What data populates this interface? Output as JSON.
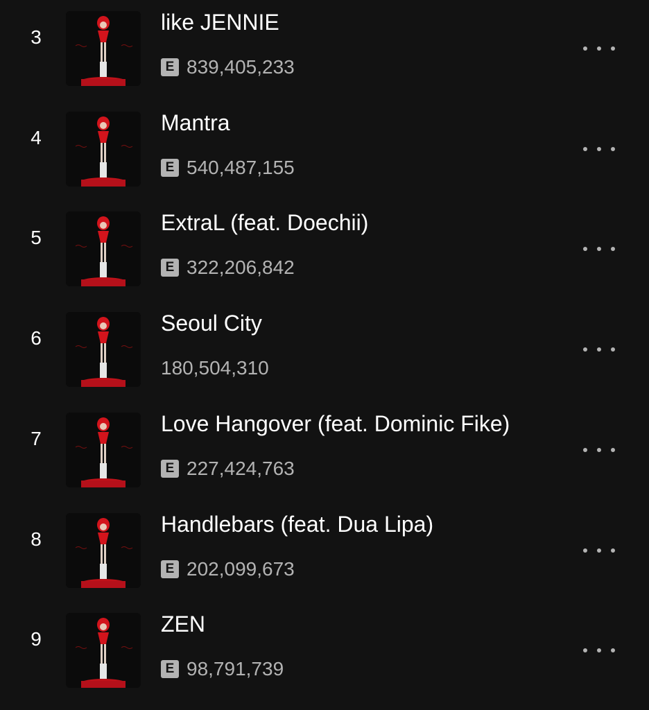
{
  "accent_explicit_bg": "#b3b3b3",
  "tracks": [
    {
      "rank": "3",
      "title": "like JENNIE",
      "explicit": true,
      "explicit_label": "E",
      "plays": "839,405,233",
      "cover_icon": "album-cover-ruby",
      "more_icon": "more-options-icon"
    },
    {
      "rank": "4",
      "title": "Mantra",
      "explicit": true,
      "explicit_label": "E",
      "plays": "540,487,155",
      "cover_icon": "album-cover-ruby",
      "more_icon": "more-options-icon"
    },
    {
      "rank": "5",
      "title": "ExtraL (feat. Doechii)",
      "explicit": true,
      "explicit_label": "E",
      "plays": "322,206,842",
      "cover_icon": "album-cover-ruby",
      "more_icon": "more-options-icon"
    },
    {
      "rank": "6",
      "title": "Seoul City",
      "explicit": false,
      "explicit_label": "",
      "plays": "180,504,310",
      "cover_icon": "album-cover-ruby",
      "more_icon": "more-options-icon"
    },
    {
      "rank": "7",
      "title": "Love Hangover (feat. Dominic Fike)",
      "explicit": true,
      "explicit_label": "E",
      "plays": "227,424,763",
      "cover_icon": "album-cover-ruby",
      "more_icon": "more-options-icon"
    },
    {
      "rank": "8",
      "title": "Handlebars (feat. Dua Lipa)",
      "explicit": true,
      "explicit_label": "E",
      "plays": "202,099,673",
      "cover_icon": "album-cover-ruby",
      "more_icon": "more-options-icon"
    },
    {
      "rank": "9",
      "title": "ZEN",
      "explicit": true,
      "explicit_label": "E",
      "plays": "98,791,739",
      "cover_icon": "album-cover-ruby",
      "more_icon": "more-options-icon"
    }
  ]
}
